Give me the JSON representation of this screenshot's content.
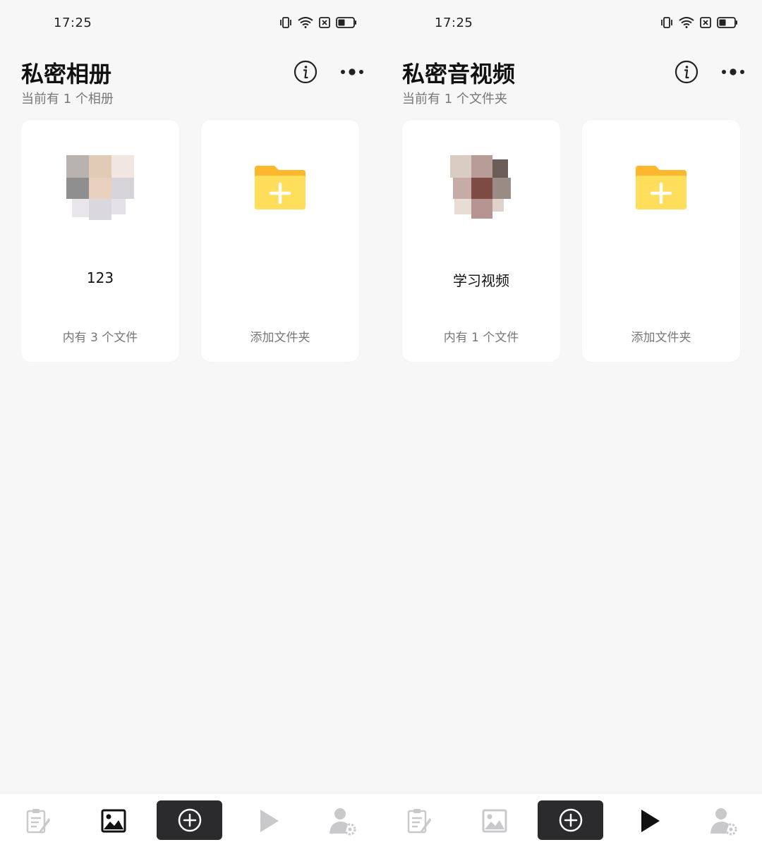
{
  "screens": [
    {
      "status": {
        "time": "17:25"
      },
      "header": {
        "title": "私密相册",
        "subtitle": "当前有 1 个相册"
      },
      "cards": [
        {
          "title": "123",
          "count": "内有 3 个文件",
          "thumbnail": "pixelated-photo"
        },
        {
          "add_label": "添加文件夹",
          "icon": "folder-add-icon"
        }
      ],
      "tabbar": {
        "active": "photos"
      }
    },
    {
      "status": {
        "time": "17:25"
      },
      "header": {
        "title": "私密音视频",
        "subtitle": "当前有 1 个文件夹"
      },
      "cards": [
        {
          "title": "学习视频",
          "count": "内有 1 个文件",
          "thumbnail": "pixelated-video"
        },
        {
          "add_label": "添加文件夹",
          "icon": "folder-add-icon"
        }
      ],
      "tabbar": {
        "active": "media"
      }
    }
  ],
  "colors": {
    "background": "#f7f7f8",
    "card": "#ffffff",
    "folder": "#ffd84d",
    "folder_tab": "#ffb82e",
    "add_button": "#2b2b2d",
    "active_icon": "#111111",
    "inactive_icon": "#c9c9cc"
  },
  "icons": [
    "vibrate-icon",
    "wifi-icon",
    "sim-x-icon",
    "battery-icon",
    "info-icon",
    "more-icon",
    "notes-icon",
    "image-icon",
    "add-icon",
    "play-icon",
    "user-settings-icon"
  ]
}
